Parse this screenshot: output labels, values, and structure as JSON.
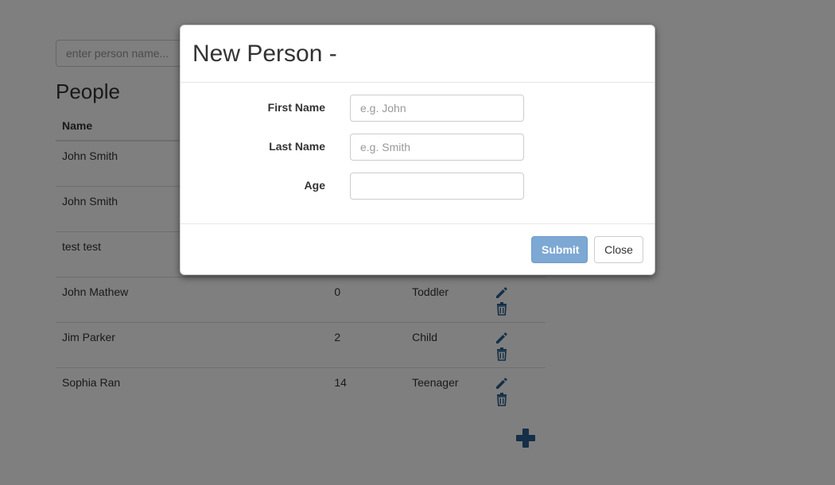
{
  "search": {
    "placeholder": "enter person name..."
  },
  "people": {
    "title": "People",
    "headers": [
      "Name",
      "",
      "",
      ""
    ],
    "rows": [
      {
        "name": "John Smith",
        "age": "",
        "category": ""
      },
      {
        "name": "John Smith",
        "age": "",
        "category": ""
      },
      {
        "name": "test test",
        "age": "",
        "category": ""
      },
      {
        "name": "John Mathew",
        "age": "0",
        "category": "Toddler"
      },
      {
        "name": "Jim Parker",
        "age": "2",
        "category": "Child"
      },
      {
        "name": "Sophia Ran",
        "age": "14",
        "category": "Teenager"
      }
    ]
  },
  "icons": {
    "edit": "pencil-icon",
    "delete": "trash-icon",
    "add": "plus-icon"
  },
  "colors": {
    "accent": "#285e8e",
    "submit": "#7da8d3"
  },
  "modal": {
    "title": "New Person -",
    "fields": [
      {
        "label": "First Name",
        "placeholder": "e.g. John",
        "value": ""
      },
      {
        "label": "Last Name",
        "placeholder": "e.g. Smith",
        "value": ""
      },
      {
        "label": "Age",
        "placeholder": "",
        "value": ""
      }
    ],
    "submit_label": "Submit",
    "close_label": "Close"
  }
}
